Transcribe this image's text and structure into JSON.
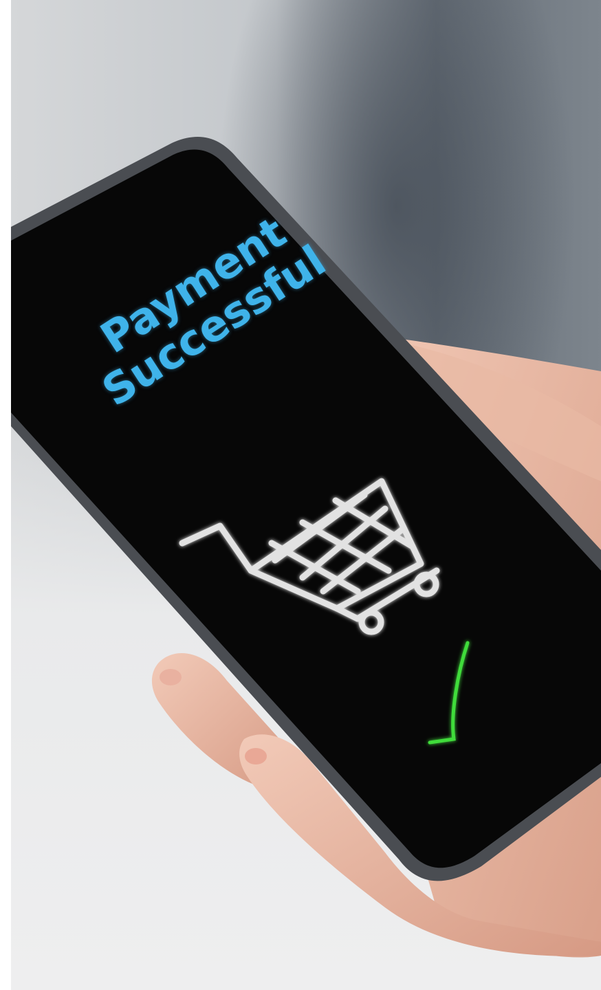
{
  "screen": {
    "title_line1": "Payment",
    "title_line2": "Successful"
  },
  "icons": {
    "cart": "shopping-cart-icon",
    "check": "checkmark-icon"
  },
  "colors": {
    "text": "#3fb3ea",
    "cart": "#e2e2e2",
    "check": "#3fdc3a",
    "screen": "#070707"
  }
}
